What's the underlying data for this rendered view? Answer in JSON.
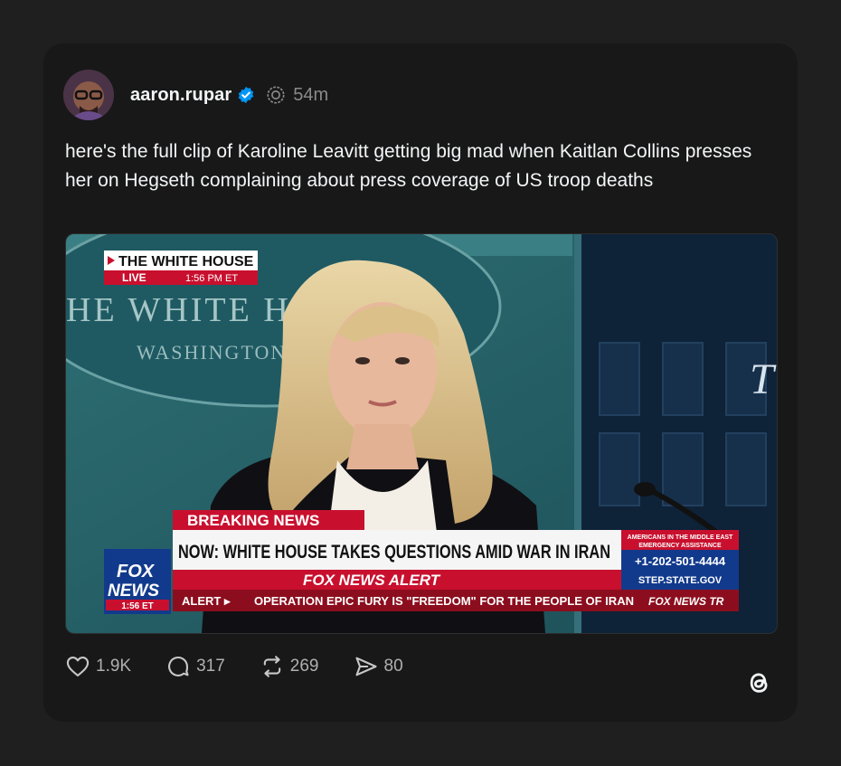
{
  "post": {
    "username": "aaron.rupar",
    "time": "54m",
    "text": "here's the full clip of Karoline Leavitt getting big mad when Kaitlan Collins presses her on Hegseth complaining about press coverage of US troop deaths"
  },
  "video": {
    "banner_title": "THE WHITE HOUSE",
    "live_label": "LIVE",
    "live_time": "1:56 PM ET",
    "wall_text_1": "HE WHITE HO",
    "wall_text_2": "WASHINGTON",
    "backdrop_letter": "T",
    "breaking_label": "BREAKING NEWS",
    "headline": "NOW: WHITE HOUSE TAKES QUESTIONS AMID WAR IN IRAN",
    "alert_label": "FOX NEWS ALERT",
    "alert_prefix": "ALERT ▸",
    "ticker": "OPERATION EPIC FURY IS \"FREEDOM\" FOR THE PEOPLE OF IRAN",
    "ticker_tail": "FOX NEWS TR",
    "logo_line1": "FOX",
    "logo_line2": "NEWS",
    "logo_time": "1:56 ET",
    "side_line1": "AMERICANS IN THE MIDDLE EAST",
    "side_line2": "EMERGENCY ASSISTANCE",
    "side_phone": "+1-202-501-4444",
    "side_site": "STEP.STATE.GOV"
  },
  "actions": {
    "likes": "1.9K",
    "replies": "317",
    "reposts": "269",
    "shares": "80"
  },
  "colors": {
    "background": "#1f1f1f",
    "card": "#181818",
    "verified": "#0095f6",
    "fox_red": "#c8102e",
    "fox_blue": "#123a8c"
  }
}
